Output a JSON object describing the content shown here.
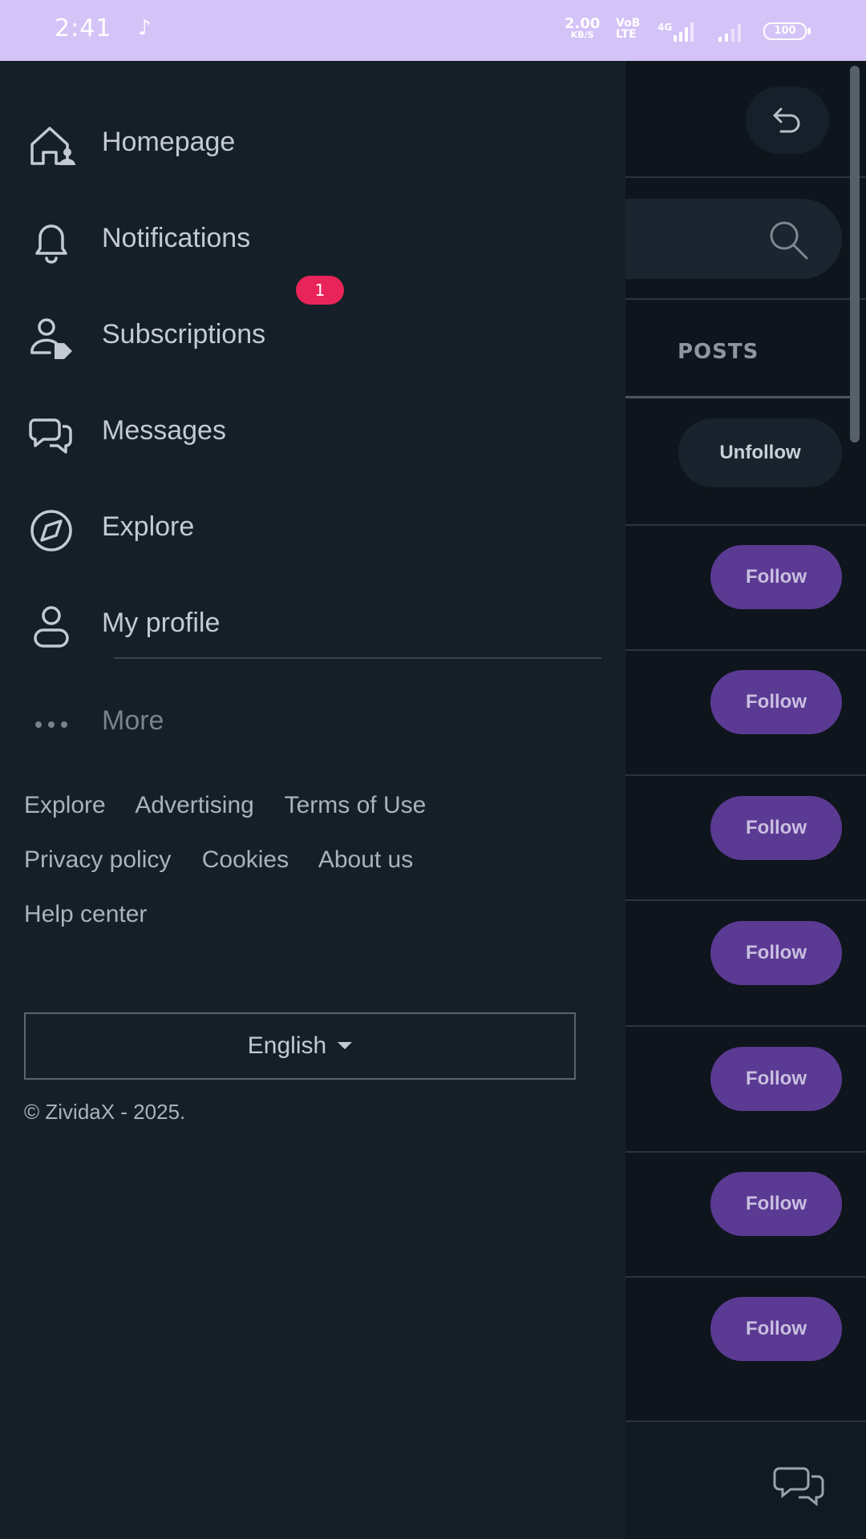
{
  "status_bar": {
    "time": "2:41",
    "net_speed_value": "2.00",
    "net_speed_unit": "KB/S",
    "volte": "VoB",
    "volte2": "LTE",
    "network": "4G",
    "battery": "100"
  },
  "drawer": {
    "menu": [
      {
        "label": "Homepage",
        "icon": "home-icon"
      },
      {
        "label": "Notifications",
        "icon": "bell-icon",
        "badge": "1"
      },
      {
        "label": "Subscriptions",
        "icon": "user-tag-icon"
      },
      {
        "label": "Messages",
        "icon": "chat-icon"
      },
      {
        "label": "Explore",
        "icon": "compass-icon"
      },
      {
        "label": "My profile",
        "icon": "profile-icon"
      }
    ],
    "more_label": "More",
    "footer_links": [
      [
        "Explore",
        "Advertising",
        "Terms of Use"
      ],
      [
        "Privacy policy",
        "Cookies",
        "About us"
      ],
      [
        "Help center"
      ]
    ],
    "language": "English",
    "copyright": "© ZividaX - 2025."
  },
  "background": {
    "tab_label": "POSTS",
    "unfollow_label": "Unfollow",
    "follow_label": "Follow"
  },
  "colors": {
    "drawer_bg": "#151f28",
    "follow_bg": "#5b3a93",
    "badge_bg": "#e8245a",
    "statusbar_bg": "#d4c3f7"
  }
}
